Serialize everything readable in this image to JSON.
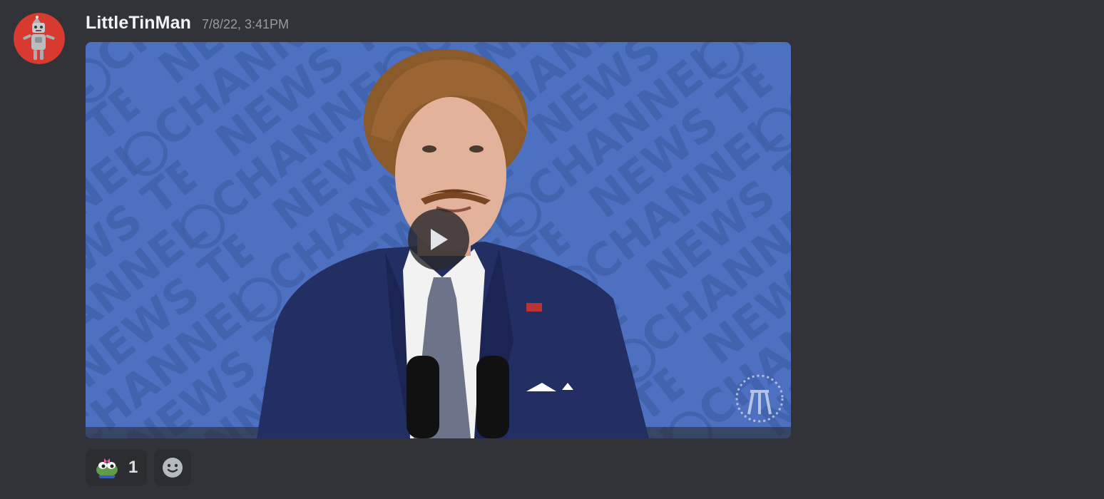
{
  "message": {
    "author": "LittleTinMan",
    "timestamp": "7/8/22, 3:41PM",
    "avatar_icon": "tin-man-robot-icon",
    "avatar_bg": "#d93a2f"
  },
  "attachment": {
    "type": "video",
    "play_icon": "play-icon",
    "background_words": [
      "CHANNEL",
      "NEWS",
      "TEAM"
    ],
    "accent": "#4b6fbd"
  },
  "reactions": [
    {
      "emoji_icon": "frog-with-bow-icon",
      "count": "1"
    }
  ],
  "add_reaction_icon": "smiley-face-icon",
  "colors": {
    "background": "#313338",
    "username": "#f2f3f5",
    "timestamp": "#949ba4",
    "pill": "#2b2d31"
  }
}
